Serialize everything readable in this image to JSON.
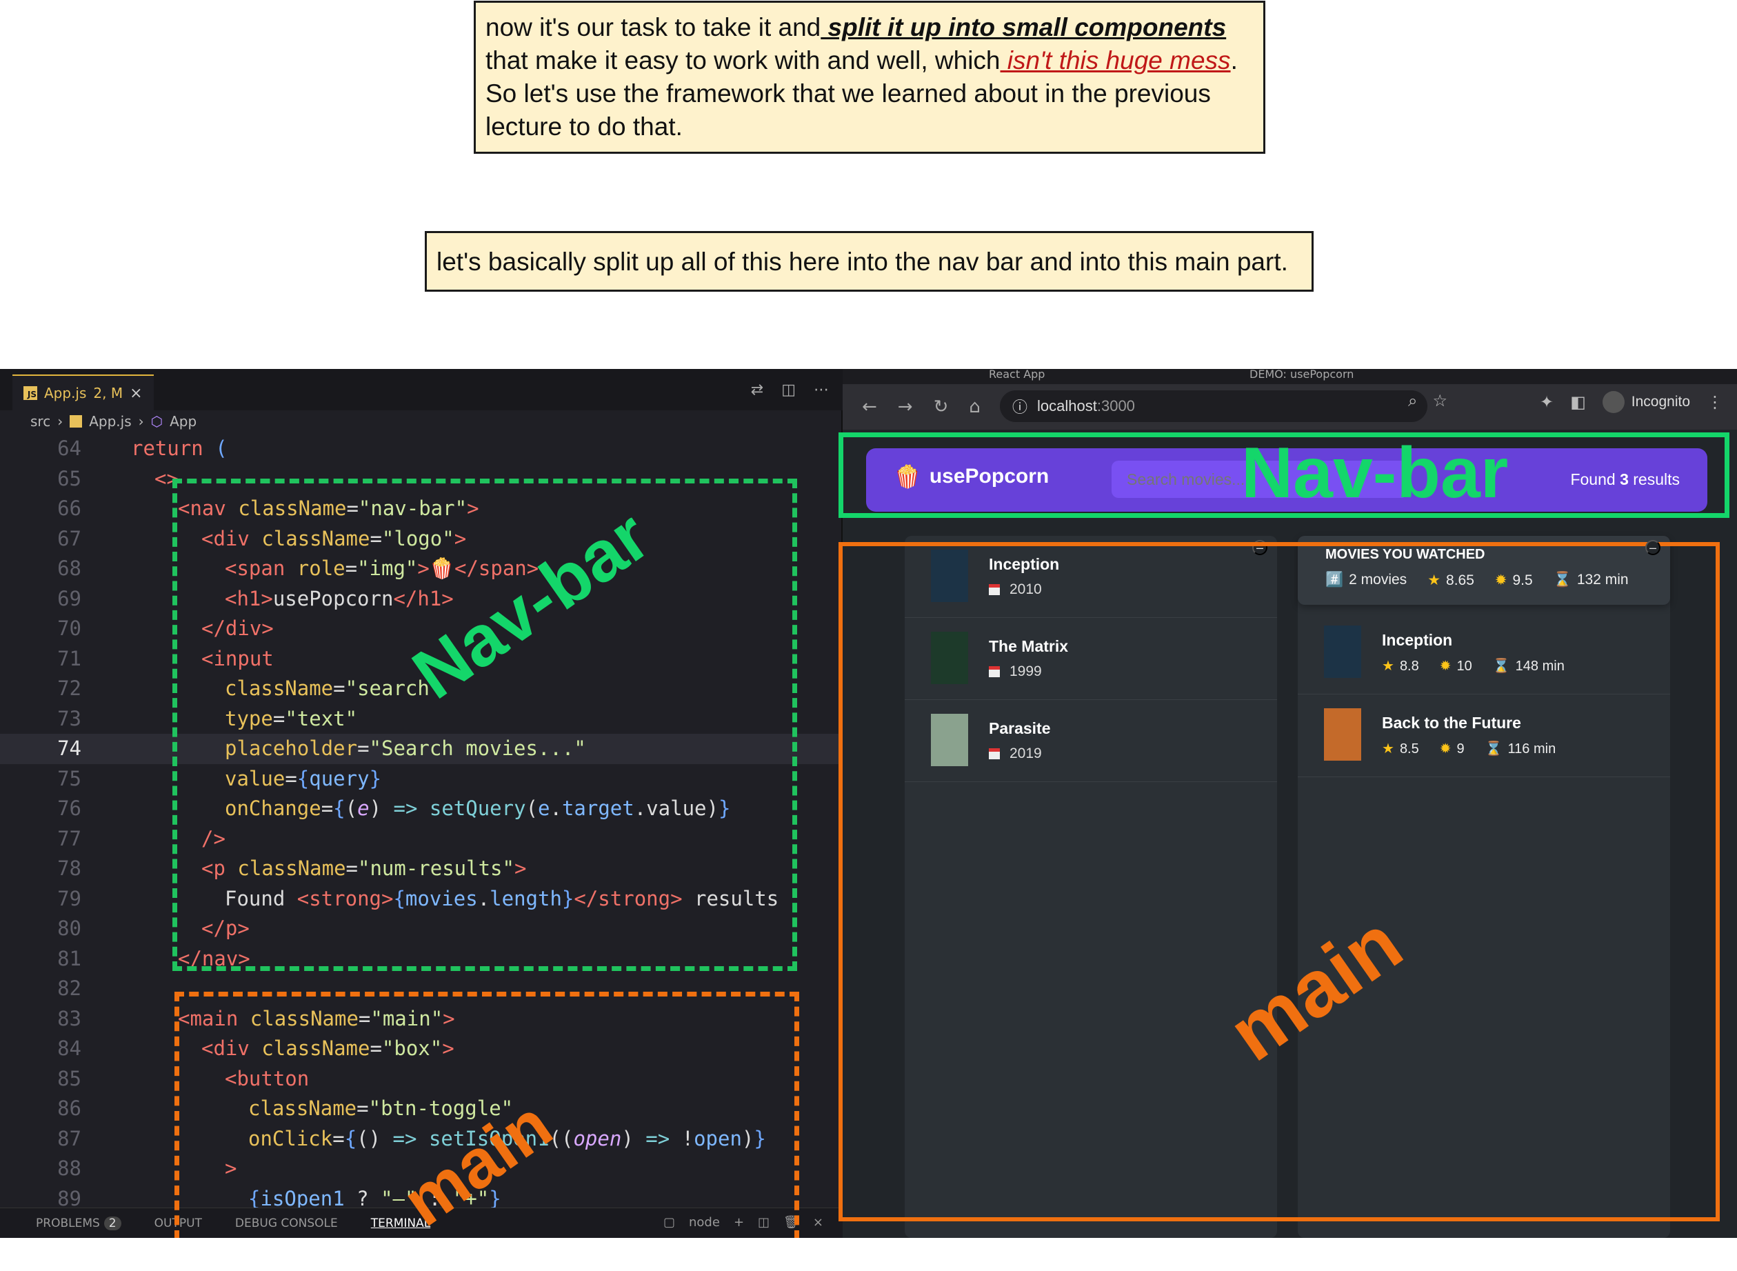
{
  "notes": {
    "note1": {
      "part1": "now it's our task to take it and",
      "emph1": " split it up into small components",
      "part2": " that make it easy to work with and well, which",
      "emph2": " isn't this huge mess",
      "part3": ".",
      "part4": " So let's use the framework that we learned about in the previous lecture to do that."
    },
    "note2": "let's basically split up all of this here into the nav bar and into this main part."
  },
  "editor": {
    "tab_label": "App.js",
    "tab_status": "2, M",
    "tab_close": "×",
    "breadcrumb": [
      "src",
      "App.js",
      "App"
    ],
    "lines": [
      {
        "n": "64",
        "html": "<span class=\"kw\">return</span> <span class=\"brace\">(</span>",
        "indent": 0
      },
      {
        "n": "65",
        "html": "<span class=\"tag\">&lt;&gt;</span>",
        "indent": 1
      },
      {
        "n": "66",
        "html": "<span class=\"tag\">&lt;nav</span> <span class=\"attr\">className</span>=<span class=\"str\">\"nav-bar\"</span><span class=\"tag\">&gt;</span>",
        "indent": 2
      },
      {
        "n": "67",
        "html": "<span class=\"tag\">&lt;div</span> <span class=\"attr\">className</span>=<span class=\"str\">\"logo\"</span><span class=\"tag\">&gt;</span>",
        "indent": 3
      },
      {
        "n": "68",
        "html": "<span class=\"tag\">&lt;span</span> <span class=\"attr\">role</span>=<span class=\"str\">\"img\"</span><span class=\"tag\">&gt;</span>🍿<span class=\"tag\">&lt;/span&gt;</span>",
        "indent": 4
      },
      {
        "n": "69",
        "html": "<span class=\"tag\">&lt;h1&gt;</span>usePopcorn<span class=\"tag\">&lt;/h1&gt;</span>",
        "indent": 4
      },
      {
        "n": "70",
        "html": "<span class=\"tag\">&lt;/div&gt;</span>",
        "indent": 3
      },
      {
        "n": "71",
        "html": "<span class=\"tag\">&lt;input</span>",
        "indent": 3
      },
      {
        "n": "72",
        "html": "<span class=\"attr\">className</span>=<span class=\"str\">\"search\"</span>",
        "indent": 4
      },
      {
        "n": "73",
        "html": "<span class=\"attr\">type</span>=<span class=\"str\">\"text\"</span>",
        "indent": 4
      },
      {
        "n": "74",
        "html": "<span class=\"attr\">placeholder</span>=<span class=\"str\">\"Search movies...\"</span>",
        "indent": 4,
        "current": true
      },
      {
        "n": "75",
        "html": "<span class=\"attr\">value</span>=<span class=\"brace\">{</span><span class=\"var\">query</span><span class=\"brace\">}</span>",
        "indent": 4
      },
      {
        "n": "76",
        "html": "<span class=\"attr\">onChange</span>=<span class=\"brace\">{</span>(<span class=\"param\">e</span>) <span class=\"arrow\">=&gt;</span> <span class=\"fn\">setQuery</span>(<span class=\"var\">e</span>.<span class=\"var\">target</span>.value)<span class=\"brace\">}</span>",
        "indent": 4
      },
      {
        "n": "77",
        "html": "<span class=\"tag\">/&gt;</span>",
        "indent": 3
      },
      {
        "n": "78",
        "html": "<span class=\"tag\">&lt;p</span> <span class=\"attr\">className</span>=<span class=\"str\">\"num-results\"</span><span class=\"tag\">&gt;</span>",
        "indent": 3
      },
      {
        "n": "79",
        "html": "Found <span class=\"tag\">&lt;strong&gt;</span><span class=\"brace\">{</span><span class=\"var\">movies</span>.<span class=\"var\">length</span><span class=\"brace\">}</span><span class=\"tag\">&lt;/strong&gt;</span> results",
        "indent": 4
      },
      {
        "n": "80",
        "html": "<span class=\"tag\">&lt;/p&gt;</span>",
        "indent": 3
      },
      {
        "n": "81",
        "html": "<span class=\"tag\">&lt;/nav&gt;</span>",
        "indent": 2
      },
      {
        "n": "82",
        "html": "",
        "indent": 0
      },
      {
        "n": "83",
        "html": "<span class=\"tag\">&lt;main</span> <span class=\"attr\">className</span>=<span class=\"str\">\"main\"</span><span class=\"tag\">&gt;</span>",
        "indent": 2
      },
      {
        "n": "84",
        "html": "<span class=\"tag\">&lt;div</span> <span class=\"attr\">className</span>=<span class=\"str\">\"box\"</span><span class=\"tag\">&gt;</span>",
        "indent": 3
      },
      {
        "n": "85",
        "html": "<span class=\"tag\">&lt;button</span>",
        "indent": 4
      },
      {
        "n": "86",
        "html": "<span class=\"attr\">className</span>=<span class=\"str\">\"btn-toggle\"</span>",
        "indent": 5
      },
      {
        "n": "87",
        "html": "<span class=\"attr\">onClick</span>=<span class=\"brace\">{</span>() <span class=\"arrow\">=&gt;</span> <span class=\"fn\">setIsOpen1</span>((<span class=\"param\">open</span>) <span class=\"arrow\">=&gt;</span> !<span class=\"var\">open</span>)<span class=\"brace\">}</span>",
        "indent": 5
      },
      {
        "n": "88",
        "html": "<span class=\"tag\">&gt;</span>",
        "indent": 4
      },
      {
        "n": "89",
        "html": "<span class=\"brace\">{</span><span class=\"var\">isOpen1</span> ? <span class=\"str\">\"–\"</span> : <span class=\"str\">\"+\"</span><span class=\"brace\">}</span>",
        "indent": 5
      }
    ],
    "panel_tabs": [
      "PROBLEMS",
      "OUTPUT",
      "DEBUG CONSOLE",
      "TERMINAL"
    ],
    "problems_count": "2",
    "terminal_label": "node"
  },
  "browser": {
    "tabs": [
      "React App",
      "DEMO: usePopcorn"
    ],
    "url_host": "localhost",
    "url_port": ":3000",
    "profile": "Incognito"
  },
  "app": {
    "logo_emoji": "🍿",
    "logo_text": "usePopcorn",
    "search_placeholder": "Search movies...",
    "results_prefix": "Found ",
    "results_count": "3",
    "results_suffix": " results",
    "toggle": "–",
    "movies": [
      {
        "title": "Inception",
        "year": "2010",
        "poster_color": "#1c3346"
      },
      {
        "title": "The Matrix",
        "year": "1999",
        "poster_color": "#1d3a2a"
      },
      {
        "title": "Parasite",
        "year": "2019",
        "poster_color": "#8aa28e"
      }
    ],
    "summary_title": "MOVIES YOU WATCHED",
    "summary_stats": [
      "2 movies",
      "8.65",
      "9.5",
      "132 min"
    ],
    "watched": [
      {
        "title": "Inception",
        "imdb": "8.8",
        "user": "10",
        "runtime": "148 min",
        "poster_color": "#1c3346"
      },
      {
        "title": "Back to the Future",
        "imdb": "8.5",
        "user": "9",
        "runtime": "116 min",
        "poster_color": "#c46a2a"
      }
    ]
  },
  "overlays": {
    "navbar_label": "Nav-bar",
    "main_label": "main"
  },
  "colors": {
    "navbar_bg": "#6741d9",
    "green": "#14d66a",
    "orange": "#f07010",
    "note_bg": "#fef2cc"
  }
}
